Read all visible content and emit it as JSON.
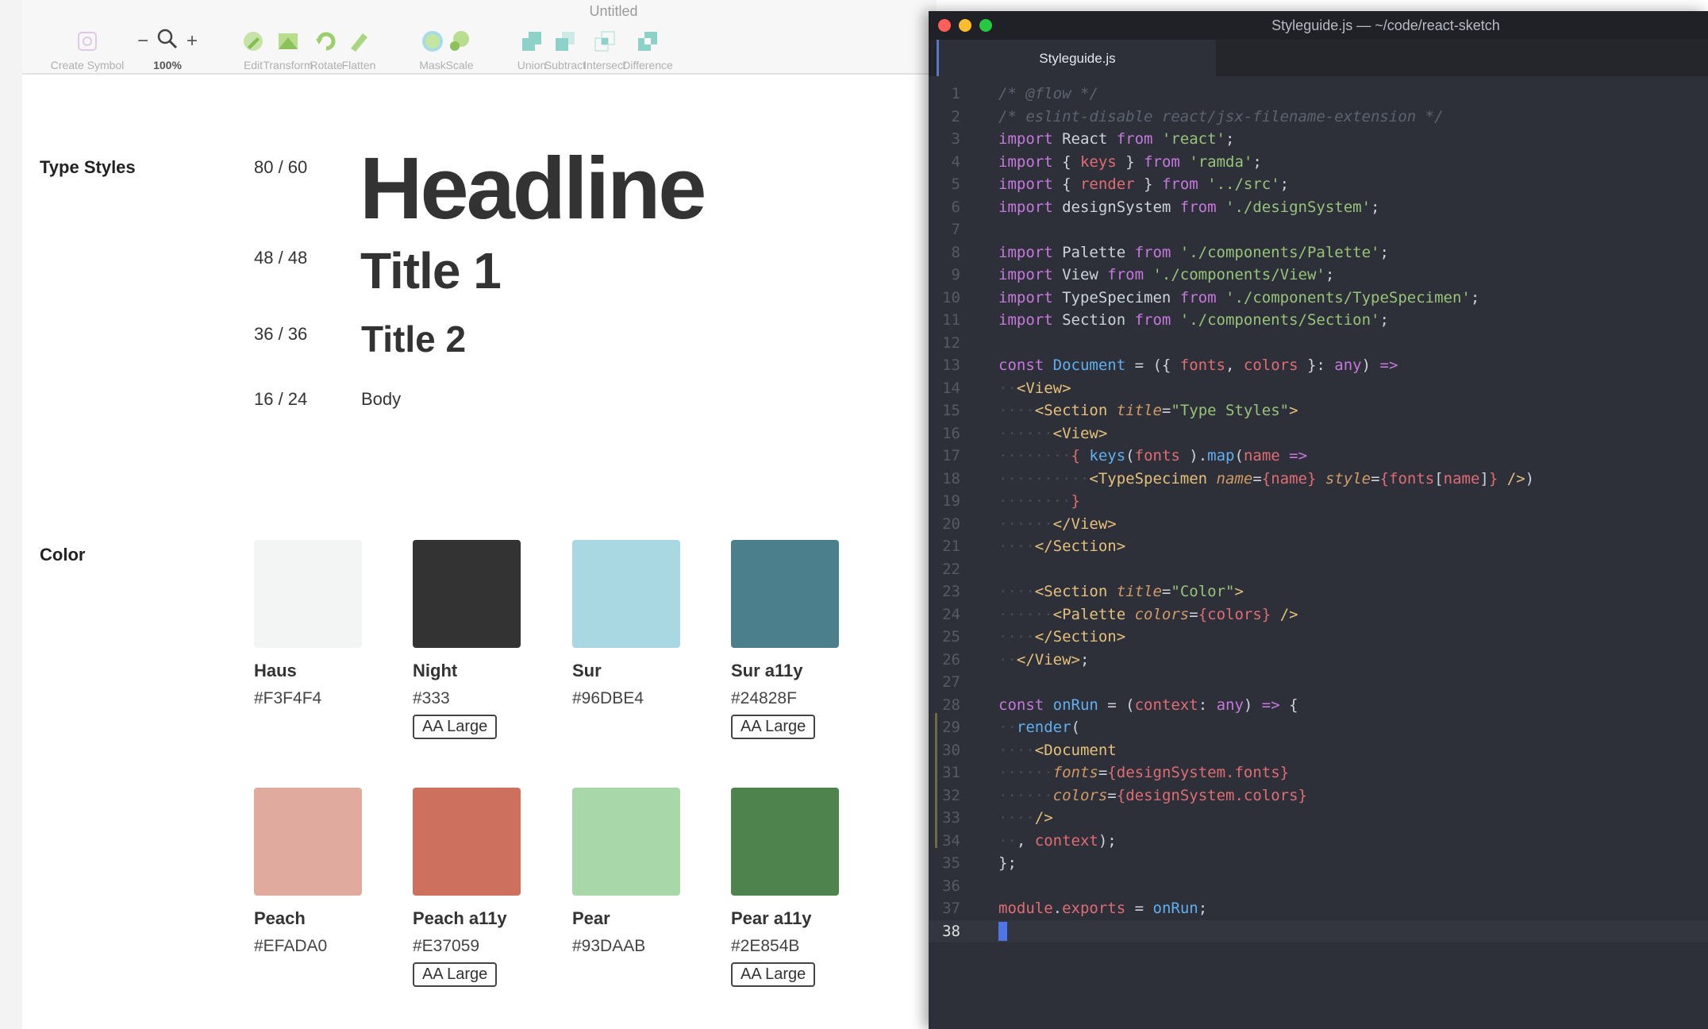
{
  "sketch": {
    "document_title": "Untitled",
    "toolbar": [
      {
        "name": "create-symbol",
        "label": "Create Symbol",
        "icon": "symbol-icon"
      },
      {
        "name": "zoom",
        "label": "100%",
        "icon": "magnifier-icon",
        "minus": "−",
        "plus": "+"
      },
      {
        "name": "edit",
        "label": "Edit",
        "icon": "pen-icon"
      },
      {
        "name": "transform",
        "label": "Transform",
        "icon": "transform-icon"
      },
      {
        "name": "rotate",
        "label": "Rotate",
        "icon": "rotate-icon"
      },
      {
        "name": "flatten",
        "label": "Flatten",
        "icon": "flatten-icon"
      },
      {
        "name": "mask",
        "label": "Mask",
        "icon": "mask-icon"
      },
      {
        "name": "scale",
        "label": "Scale",
        "icon": "scale-icon"
      },
      {
        "name": "union",
        "label": "Union",
        "icon": "union-icon"
      },
      {
        "name": "subtract",
        "label": "Subtract",
        "icon": "subtract-icon"
      },
      {
        "name": "intersect",
        "label": "Intersect",
        "icon": "intersect-icon"
      },
      {
        "name": "difference",
        "label": "Difference",
        "icon": "difference-icon"
      }
    ],
    "type_styles": {
      "title": "Type Styles",
      "items": [
        {
          "size": "80 / 60",
          "sample": "Headline"
        },
        {
          "size": "48 / 48",
          "sample": "Title 1"
        },
        {
          "size": "36 / 36",
          "sample": "Title 2"
        },
        {
          "size": "16 / 24",
          "sample": "Body"
        }
      ]
    },
    "color": {
      "title": "Color",
      "swatches": [
        {
          "name": "Haus",
          "hex": "#F3F4F4",
          "color": "#F3F4F4",
          "badge": ""
        },
        {
          "name": "Night",
          "hex": "#333",
          "color": "#333333",
          "badge": "AA Large"
        },
        {
          "name": "Sur",
          "hex": "#96DBE4",
          "color": "#A9D8E3",
          "badge": ""
        },
        {
          "name": "Sur a11y",
          "hex": "#24828F",
          "color": "#4B7F8C",
          "badge": "AA Large"
        },
        {
          "name": "Peach",
          "hex": "#EFADA0",
          "color": "#E1AA9E",
          "badge": ""
        },
        {
          "name": "Peach a11y",
          "hex": "#E37059",
          "color": "#CD705D",
          "badge": "AA Large"
        },
        {
          "name": "Pear",
          "hex": "#93DAAB",
          "color": "#A8D8AA",
          "badge": ""
        },
        {
          "name": "Pear a11y",
          "hex": "#2E854B",
          "color": "#4F834D",
          "badge": "AA Large"
        }
      ]
    }
  },
  "editor": {
    "window_title": "Styleguide.js — ~/code/react-sketch",
    "tab_label": "Styleguide.js",
    "current_line": 38,
    "lines": [
      [
        [
          "c-com",
          "/* @flow */"
        ]
      ],
      [
        [
          "c-com",
          "/* eslint-disable react/jsx-filename-extension */"
        ]
      ],
      [
        [
          "c-kw",
          "import "
        ],
        [
          "",
          "React "
        ],
        [
          "c-kw",
          "from "
        ],
        [
          "c-str",
          "'react'"
        ],
        [
          "",
          ";"
        ]
      ],
      [
        [
          "c-kw",
          "import "
        ],
        [
          "",
          "{ "
        ],
        [
          "c-var",
          "keys"
        ],
        [
          "",
          " } "
        ],
        [
          "c-kw",
          "from "
        ],
        [
          "c-str",
          "'ramda'"
        ],
        [
          "",
          ";"
        ]
      ],
      [
        [
          "c-kw",
          "import "
        ],
        [
          "",
          "{ "
        ],
        [
          "c-var",
          "render"
        ],
        [
          "",
          " } "
        ],
        [
          "c-kw",
          "from "
        ],
        [
          "c-str",
          "'../src'"
        ],
        [
          "",
          ";"
        ]
      ],
      [
        [
          "c-kw",
          "import "
        ],
        [
          "",
          "designSystem "
        ],
        [
          "c-kw",
          "from "
        ],
        [
          "c-str",
          "'./designSystem'"
        ],
        [
          "",
          ";"
        ]
      ],
      [],
      [
        [
          "c-kw",
          "import "
        ],
        [
          "",
          "Palette "
        ],
        [
          "c-kw",
          "from "
        ],
        [
          "c-str",
          "'./components/Palette'"
        ],
        [
          "",
          ";"
        ]
      ],
      [
        [
          "c-kw",
          "import "
        ],
        [
          "",
          "View "
        ],
        [
          "c-kw",
          "from "
        ],
        [
          "c-str",
          "'./components/View'"
        ],
        [
          "",
          ";"
        ]
      ],
      [
        [
          "c-kw",
          "import "
        ],
        [
          "",
          "TypeSpecimen "
        ],
        [
          "c-kw",
          "from "
        ],
        [
          "c-str",
          "'./components/TypeSpecimen'"
        ],
        [
          "",
          ";"
        ]
      ],
      [
        [
          "c-kw",
          "import "
        ],
        [
          "",
          "Section "
        ],
        [
          "c-kw",
          "from "
        ],
        [
          "c-str",
          "'./components/Section'"
        ],
        [
          "",
          ";"
        ]
      ],
      [],
      [
        [
          "c-kw",
          "const "
        ],
        [
          "c-fn",
          "Document"
        ],
        [
          "",
          " = ({ "
        ],
        [
          "c-var",
          "fonts"
        ],
        [
          "",
          ", "
        ],
        [
          "c-var",
          "colors"
        ],
        [
          "",
          " }: "
        ],
        [
          "c-kw",
          "any"
        ],
        [
          "",
          ") "
        ],
        [
          "c-kw",
          "=>"
        ]
      ],
      [
        [
          "c-ws",
          "··"
        ],
        [
          "c-tag",
          "<View>"
        ]
      ],
      [
        [
          "c-ws",
          "····"
        ],
        [
          "c-tag",
          "<Section "
        ],
        [
          "c-attr",
          "title"
        ],
        [
          "",
          "="
        ],
        [
          "c-str",
          "\"Type Styles\""
        ],
        [
          "c-tag",
          ">"
        ]
      ],
      [
        [
          "c-ws",
          "······"
        ],
        [
          "c-tag",
          "<View>"
        ]
      ],
      [
        [
          "c-ws",
          "········"
        ],
        [
          "c-br",
          "{ "
        ],
        [
          "c-fn",
          "keys"
        ],
        [
          "",
          "("
        ],
        [
          "c-var",
          "fonts"
        ],
        [
          "",
          " )."
        ],
        [
          "c-fn",
          "map"
        ],
        [
          "",
          "("
        ],
        [
          "c-var",
          "name"
        ],
        [
          "",
          " "
        ],
        [
          "c-kw",
          "=>"
        ]
      ],
      [
        [
          "c-ws",
          "··········"
        ],
        [
          "c-tag",
          "<TypeSpecimen "
        ],
        [
          "c-attr",
          "name"
        ],
        [
          "",
          "="
        ],
        [
          "c-br",
          "{"
        ],
        [
          "c-var",
          "name"
        ],
        [
          "c-br",
          "}"
        ],
        [
          "",
          " "
        ],
        [
          "c-attr",
          "style"
        ],
        [
          "",
          "="
        ],
        [
          "c-br",
          "{"
        ],
        [
          "c-var",
          "fonts"
        ],
        [
          "",
          "["
        ],
        [
          "c-var",
          "name"
        ],
        [
          "",
          "]"
        ],
        [
          "c-br",
          "}"
        ],
        [
          "",
          " "
        ],
        [
          "c-tag",
          "/>"
        ],
        [
          "",
          ")"
        ]
      ],
      [
        [
          "c-ws",
          "········"
        ],
        [
          "c-br",
          "}"
        ]
      ],
      [
        [
          "c-ws",
          "······"
        ],
        [
          "c-tag",
          "</View>"
        ]
      ],
      [
        [
          "c-ws",
          "····"
        ],
        [
          "c-tag",
          "</Section>"
        ]
      ],
      [],
      [
        [
          "c-ws",
          "····"
        ],
        [
          "c-tag",
          "<Section "
        ],
        [
          "c-attr",
          "title"
        ],
        [
          "",
          "="
        ],
        [
          "c-str",
          "\"Color\""
        ],
        [
          "c-tag",
          ">"
        ]
      ],
      [
        [
          "c-ws",
          "······"
        ],
        [
          "c-tag",
          "<Palette "
        ],
        [
          "c-attr",
          "colors"
        ],
        [
          "",
          "="
        ],
        [
          "c-br",
          "{"
        ],
        [
          "c-var",
          "colors"
        ],
        [
          "c-br",
          "}"
        ],
        [
          "",
          " "
        ],
        [
          "c-tag",
          "/>"
        ]
      ],
      [
        [
          "c-ws",
          "····"
        ],
        [
          "c-tag",
          "</Section>"
        ]
      ],
      [
        [
          "c-ws",
          "··"
        ],
        [
          "c-tag",
          "</View>"
        ],
        [
          "",
          ";"
        ]
      ],
      [],
      [
        [
          "c-kw",
          "const "
        ],
        [
          "c-fn",
          "onRun"
        ],
        [
          "",
          " = ("
        ],
        [
          "c-var",
          "context"
        ],
        [
          "",
          ": "
        ],
        [
          "c-kw",
          "any"
        ],
        [
          "",
          ") "
        ],
        [
          "c-kw",
          "=>"
        ],
        [
          "",
          " {"
        ]
      ],
      [
        [
          "c-ws",
          "··"
        ],
        [
          "c-fn",
          "render"
        ],
        [
          "",
          "("
        ]
      ],
      [
        [
          "c-ws",
          "····"
        ],
        [
          "c-tag",
          "<Document"
        ]
      ],
      [
        [
          "c-ws",
          "······"
        ],
        [
          "c-attr",
          "fonts"
        ],
        [
          "",
          "="
        ],
        [
          "c-br",
          "{"
        ],
        [
          "c-var",
          "designSystem.fonts"
        ],
        [
          "c-br",
          "}"
        ]
      ],
      [
        [
          "c-ws",
          "······"
        ],
        [
          "c-attr",
          "colors"
        ],
        [
          "",
          "="
        ],
        [
          "c-br",
          "{"
        ],
        [
          "c-var",
          "designSystem.colors"
        ],
        [
          "c-br",
          "}"
        ]
      ],
      [
        [
          "c-ws",
          "····"
        ],
        [
          "c-tag",
          "/>"
        ]
      ],
      [
        [
          "c-ws",
          "··"
        ],
        [
          "",
          ", "
        ],
        [
          "c-var",
          "context"
        ],
        [
          "",
          ");"
        ]
      ],
      [
        [
          "",
          "};"
        ]
      ],
      [],
      [
        [
          "c-var",
          "module"
        ],
        [
          "",
          "."
        ],
        [
          "c-var",
          "exports"
        ],
        [
          "",
          " = "
        ],
        [
          "c-fn",
          "onRun"
        ],
        [
          "",
          ";"
        ]
      ],
      []
    ]
  },
  "colors": {
    "close": "#FF5F57",
    "minimize": "#FEBC2E",
    "zoom": "#28C840",
    "editor_bg": "#2D3038"
  }
}
